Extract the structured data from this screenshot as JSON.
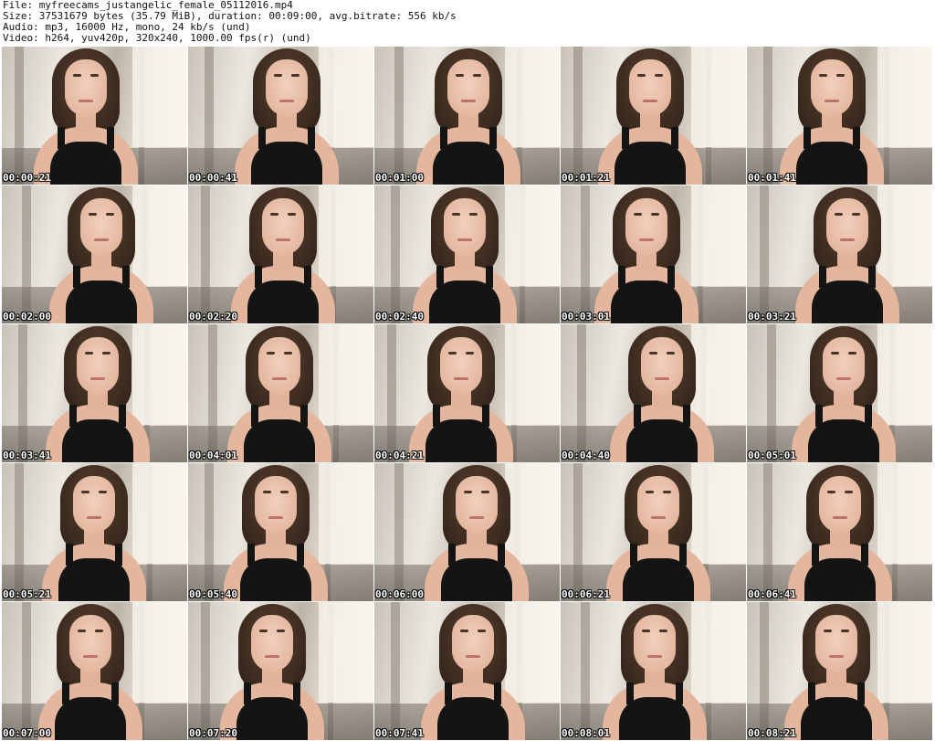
{
  "header": {
    "file_line": "File: myfreecams_justangelic_female_05112016.mp4",
    "size_line": "Size: 37531679 bytes (35.79 MiB), duration: 00:09:00, avg.bitrate: 556 kb/s",
    "audio_line": "Audio: mp3, 16000 Hz, mono, 24 kb/s (und)",
    "video_line": "Video: h264, yuv420p, 320x240, 1000.00 fps(r) (und)"
  },
  "thumbnails": [
    {
      "timestamp": "00:00:21"
    },
    {
      "timestamp": "00:00:41"
    },
    {
      "timestamp": "00:01:00"
    },
    {
      "timestamp": "00:01:21"
    },
    {
      "timestamp": "00:01:41"
    },
    {
      "timestamp": "00:02:00"
    },
    {
      "timestamp": "00:02:20"
    },
    {
      "timestamp": "00:02:40"
    },
    {
      "timestamp": "00:03:01"
    },
    {
      "timestamp": "00:03:21"
    },
    {
      "timestamp": "00:03:41"
    },
    {
      "timestamp": "00:04:01"
    },
    {
      "timestamp": "00:04:21"
    },
    {
      "timestamp": "00:04:40"
    },
    {
      "timestamp": "00:05:01"
    },
    {
      "timestamp": "00:05:21"
    },
    {
      "timestamp": "00:05:40"
    },
    {
      "timestamp": "00:06:00"
    },
    {
      "timestamp": "00:06:21"
    },
    {
      "timestamp": "00:06:41"
    },
    {
      "timestamp": "00:07:00"
    },
    {
      "timestamp": "00:07:20"
    },
    {
      "timestamp": "00:07:41"
    },
    {
      "timestamp": "00:08:01"
    },
    {
      "timestamp": "00:08:21"
    }
  ],
  "colors": {
    "background": "#ffffff",
    "header_text": "#111111",
    "timestamp_text": "#ffffff",
    "timestamp_outline": "#000000"
  }
}
